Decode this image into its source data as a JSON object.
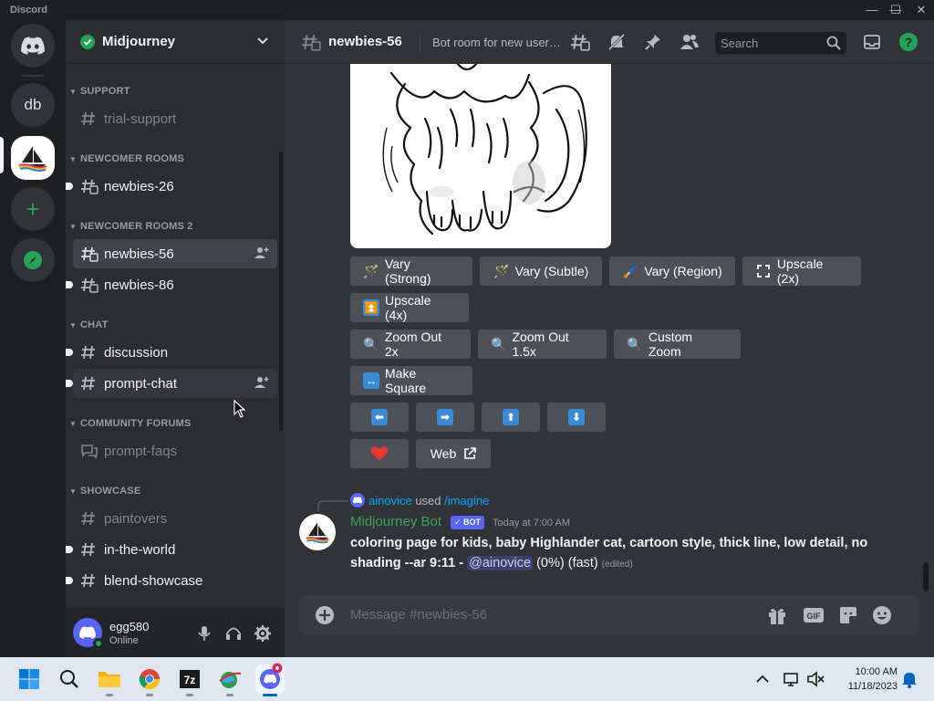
{
  "window": {
    "app_name": "Discord",
    "minimize": "—",
    "maximize": "☐",
    "close": "✕"
  },
  "servers": [
    {
      "label": ""
    },
    {
      "label": "db"
    },
    {
      "label": ""
    },
    {
      "label": "+"
    },
    {
      "label": ""
    }
  ],
  "guild": {
    "name": "Midjourney"
  },
  "categories": {
    "support": "SUPPORT",
    "newcomer": "NEWCOMER ROOMS",
    "newcomer2": "NEWCOMER ROOMS 2",
    "chat": "CHAT",
    "forums": "COMMUNITY FORUMS",
    "showcase": "SHOWCASE"
  },
  "channels": {
    "trial_support": "trial-support",
    "newbies_26": "newbies-26",
    "newbies_56": "newbies-56",
    "newbies_86": "newbies-86",
    "discussion": "discussion",
    "prompt_chat": "prompt-chat",
    "prompt_faqs": "prompt-faqs",
    "paintovers": "paintovers",
    "in_the_world": "in-the-world",
    "blend_showcase": "blend-showcase"
  },
  "user": {
    "name": "egg580",
    "status": "Online"
  },
  "topbar": {
    "channel": "newbies-56",
    "topic": "Bot room for new users. Type /imagine then describe what you want to draw.",
    "search_placeholder": "Search"
  },
  "buttons": {
    "vary_strong": "Vary (Strong)",
    "vary_subtle": "Vary (Subtle)",
    "vary_region": "Vary (Region)",
    "upscale_2x": "Upscale (2x)",
    "upscale_4x": "Upscale (4x)",
    "zoom_out_2x": "Zoom Out 2x",
    "zoom_out_15x": "Zoom Out 1.5x",
    "custom_zoom": "Custom Zoom",
    "make_square": "Make Square",
    "web": "Web"
  },
  "reply": {
    "user": "ainovice",
    "used": "used",
    "command": "/imagine"
  },
  "message": {
    "author": "Midjourney Bot",
    "badge": "✓ BOT",
    "time": "Today at 7:00 AM",
    "prompt": "coloring page for kids, baby Highlander cat, cartoon style, thick line, low detail, no shading --ar 9:11",
    "dash": " - ",
    "mention": "@ainovice",
    "progress": "(0%)",
    "mode": "(fast)",
    "edited": "(edited)"
  },
  "composer": {
    "placeholder": "Message #newbies-56"
  },
  "taskbar": {
    "time": "10:00 AM",
    "date": "11/18/2023"
  },
  "colors": {
    "accent": "#5865f2",
    "online": "#23a559",
    "bot_name": "#3ba55c",
    "mention_bg": "#3c4270",
    "link": "#00a8fc"
  }
}
